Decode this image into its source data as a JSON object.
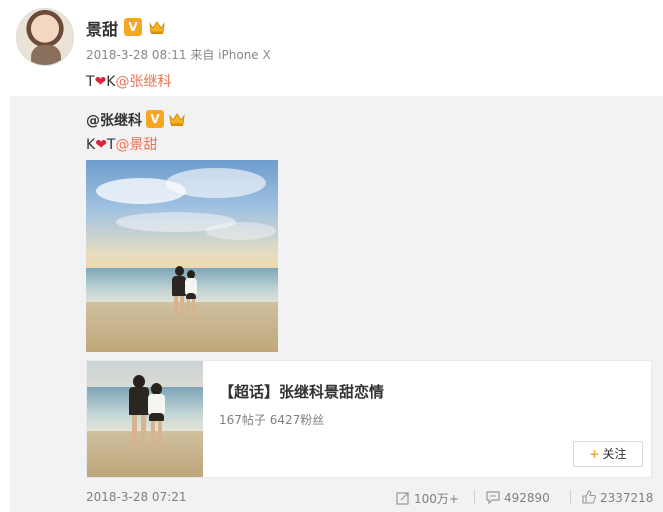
{
  "post": {
    "author": "景甜",
    "timestamp": "2018-3-28 08:11",
    "source_prefix": "来自",
    "source": "iPhone X",
    "text_before": "T",
    "text_mid": "K",
    "mention": "@张继科",
    "heart": "❤"
  },
  "repost": {
    "author": "@张继科",
    "text_before": "K",
    "text_mid": "T",
    "mention": "@景甜",
    "heart": "❤"
  },
  "topic": {
    "title": "【超话】张继科景甜恋情",
    "stats": "167帖子 6427粉丝",
    "follow_label": "关注",
    "follow_plus": "+"
  },
  "footer": {
    "time": "2018-3-28 07:21",
    "reposts": "100万+",
    "comments": "492890",
    "likes": "2337218"
  },
  "colors": {
    "mention": "#eb7350",
    "heart": "#e0213c",
    "badge": "#f5a623",
    "repost_bg": "#f2f2f5"
  },
  "icons": [
    "verified-v-icon",
    "crown-icon",
    "repost-icon",
    "comment-icon",
    "like-icon",
    "plus-icon"
  ]
}
